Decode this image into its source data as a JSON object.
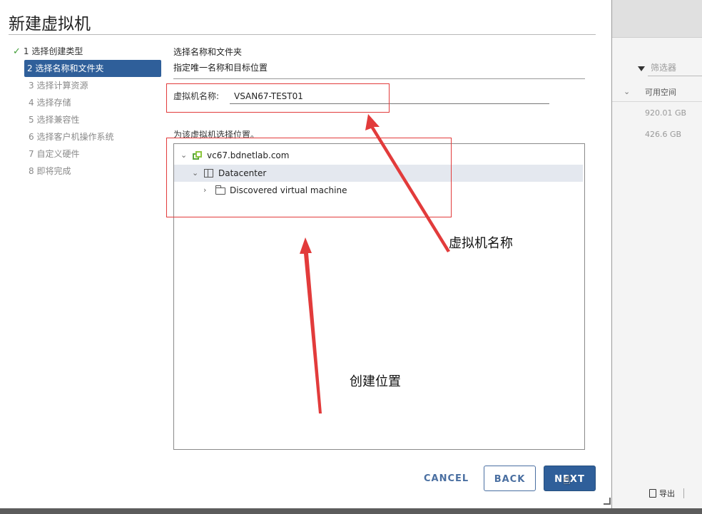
{
  "dialog": {
    "title": "新建虚拟机"
  },
  "steps": [
    {
      "label": "1 选择创建类型",
      "state": "done"
    },
    {
      "label": "2 选择名称和文件夹",
      "state": "active"
    },
    {
      "label": "3 选择计算资源",
      "state": "pending"
    },
    {
      "label": "4 选择存储",
      "state": "pending"
    },
    {
      "label": "5 选择兼容性",
      "state": "pending"
    },
    {
      "label": "6 选择客户机操作系统",
      "state": "pending"
    },
    {
      "label": "7 自定义硬件",
      "state": "pending"
    },
    {
      "label": "8 即将完成",
      "state": "pending"
    }
  ],
  "content": {
    "heading": "选择名称和文件夹",
    "subheading": "指定唯一名称和目标位置",
    "vm_name_label": "虚拟机名称:",
    "vm_name_value": "VSAN67-TEST01",
    "location_label": "为该虚拟机选择位置。",
    "tree": [
      {
        "label": "vc67.bdnetlab.com",
        "icon": "vcenter-icon",
        "expanded": true
      },
      {
        "label": "Datacenter",
        "icon": "datacenter-icon",
        "expanded": true,
        "selected": true
      },
      {
        "label": "Discovered virtual machine",
        "icon": "folder-icon",
        "expanded": false
      }
    ]
  },
  "annotations": {
    "vm_name_note": "虚拟机名称",
    "location_note": "创建位置",
    "color": "#e23b3b"
  },
  "footer": {
    "cancel": "CANCEL",
    "back": "BACK",
    "next": "NEXT"
  },
  "background_app": {
    "filter_placeholder": "筛选器",
    "column_header": "可用空间",
    "rows": [
      "920.01 GB",
      "426.6 GB"
    ],
    "export_label": "导出"
  },
  "colors": {
    "primary": "#2f5f9a",
    "link": "#4a6fa1",
    "success": "#3f9c35"
  }
}
